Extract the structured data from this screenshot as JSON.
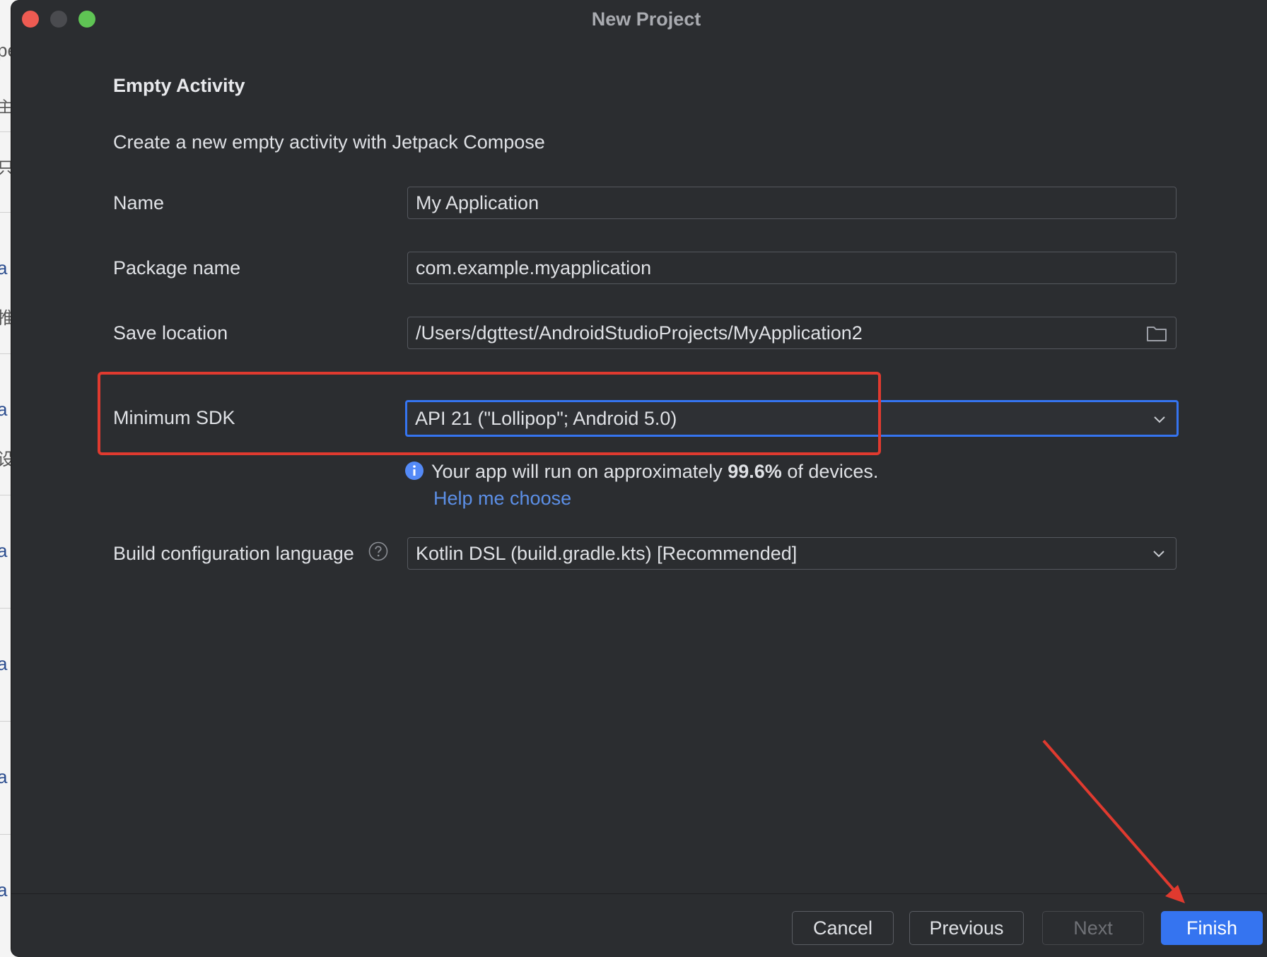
{
  "window": {
    "title": "New Project"
  },
  "template": {
    "title": "Empty Activity",
    "description": "Create a new empty activity with Jetpack Compose"
  },
  "fields": {
    "name": {
      "label": "Name",
      "value": "My Application"
    },
    "package_name": {
      "label": "Package name",
      "value": "com.example.myapplication"
    },
    "save_location": {
      "label": "Save location",
      "value": "/Users/dgttest/AndroidStudioProjects/MyApplication2",
      "icon": "folder-icon"
    },
    "minimum_sdk": {
      "label": "Minimum SDK",
      "selected": "API 21 (\"Lollipop\"; Android 5.0)"
    },
    "build_language": {
      "label": "Build configuration language",
      "selected": "Kotlin DSL (build.gradle.kts) [Recommended]",
      "icon": "help-circle-icon"
    }
  },
  "info": {
    "icon": "info-icon",
    "prefix": "Your app will run on approximately ",
    "percent": "99.6%",
    "suffix": " of devices.",
    "help_link": "Help me choose"
  },
  "buttons": {
    "cancel": "Cancel",
    "previous": "Previous",
    "next": "Next",
    "finish": "Finish"
  },
  "background_fragments": [
    "pe",
    "主",
    "只",
    "a",
    "推",
    "a",
    "设",
    "a",
    "a",
    "a",
    "a"
  ],
  "colors": {
    "window_bg": "#2b2d30",
    "accent": "#3574f0",
    "link": "#5c8fe6",
    "annotation": "#e03a2f"
  }
}
